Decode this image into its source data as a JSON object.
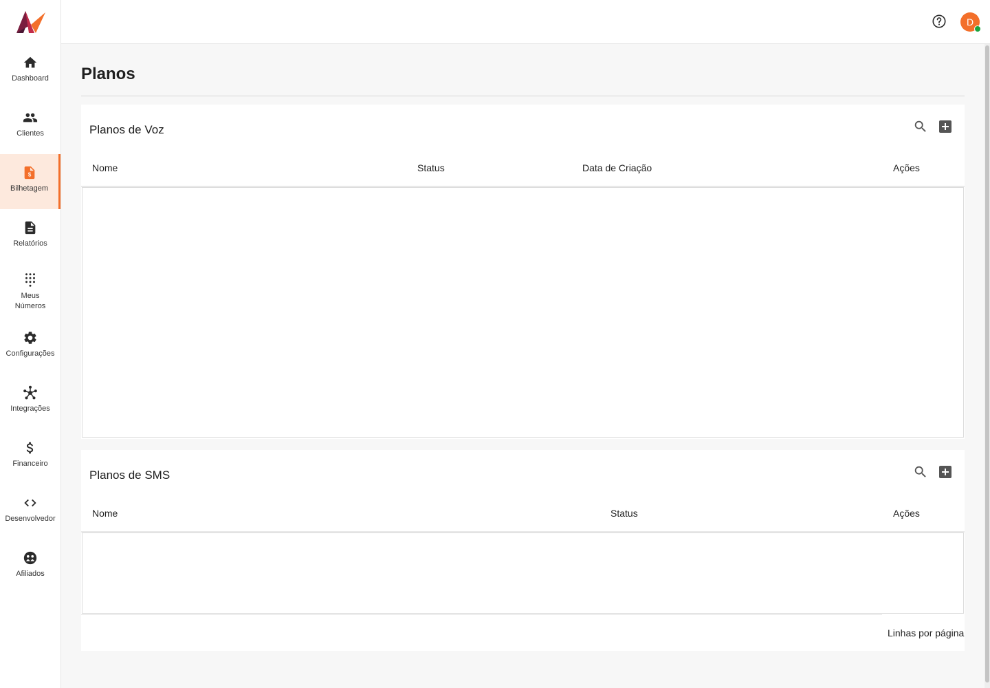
{
  "sidebar": {
    "items": [
      {
        "label": "Dashboard",
        "icon": "home-icon"
      },
      {
        "label": "Clientes",
        "icon": "users-icon"
      },
      {
        "label": "Bilhetagem",
        "icon": "invoice-icon",
        "active": true
      },
      {
        "label": "Relatórios",
        "icon": "document-icon"
      },
      {
        "label": "Meus\nNúmeros",
        "icon": "dialpad-icon"
      },
      {
        "label": "Configurações",
        "icon": "gear-icon"
      },
      {
        "label": "Integrações",
        "icon": "hub-icon"
      },
      {
        "label": "Financeiro",
        "icon": "dollar-icon"
      },
      {
        "label": "Desenvolvedor",
        "icon": "code-icon"
      },
      {
        "label": "Afiliados",
        "icon": "affiliate-icon"
      }
    ]
  },
  "header": {
    "avatar_initial": "D",
    "status": "online"
  },
  "colors": {
    "accent": "#f36f2a",
    "active_bg": "#fde9dd",
    "online": "#1aa23d"
  },
  "page": {
    "title": "Planos"
  },
  "voice_plans": {
    "title": "Planos de Voz",
    "columns": [
      "Nome",
      "Status",
      "Data de Criação",
      "Ações"
    ],
    "rows": []
  },
  "sms_plans": {
    "title": "Planos de SMS",
    "columns": [
      "Nome",
      "Status",
      "Ações"
    ],
    "rows": [],
    "rows_per_page_label": "Linhas por página"
  }
}
